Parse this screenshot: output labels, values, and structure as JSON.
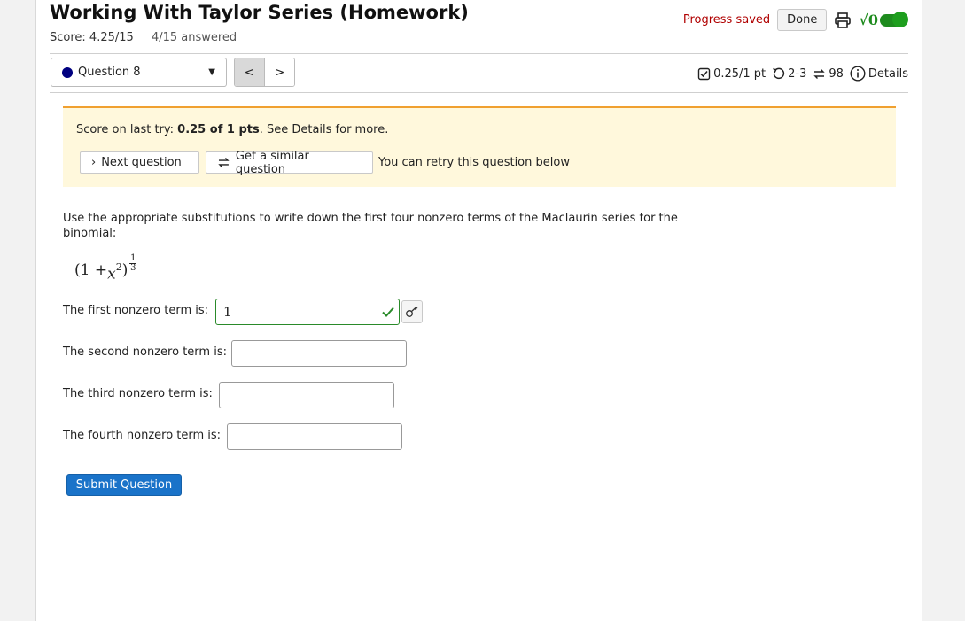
{
  "header": {
    "title": "Working With Taylor Series (Homework)",
    "score": "Score: 4.25/15",
    "answered": "4/15 answered",
    "progress_saved": "Progress saved",
    "done_label": "Done",
    "print_icon": "printer-icon",
    "math_toggle_icon": "sqrt-toggle-icon",
    "math_toggle_glyph": "√0"
  },
  "question_nav": {
    "selected_question": "Question 8",
    "prev_label": "<",
    "next_label": ">"
  },
  "question_meta": {
    "points": "0.25/1 pt",
    "attempts": "2-3",
    "versions": "98",
    "details_label": "Details"
  },
  "notice": {
    "last_try_prefix": "Score on last try: ",
    "last_try_value": "0.25 of 1 pts",
    "last_try_suffix": ". See Details for more.",
    "next_question_label": "Next question",
    "similar_question_label": "Get a similar question",
    "retry_text": "You can retry this question below"
  },
  "question": {
    "prompt": "Use the appropriate substitutions to write down the first four nonzero terms of the Maclaurin series for the binomial:",
    "expression": {
      "base_left": "(1 + ",
      "var": "x",
      "var_exp": "2",
      "base_right": ")",
      "exp_num": "1",
      "exp_den": "3"
    },
    "fields": [
      {
        "label": "The first nonzero term is:",
        "value": "1",
        "status": "correct"
      },
      {
        "label": "The second nonzero term is:",
        "value": ""
      },
      {
        "label": "The third nonzero term is:",
        "value": ""
      },
      {
        "label": "The fourth nonzero term is:",
        "value": ""
      }
    ],
    "submit_label": "Submit Question"
  },
  "colors": {
    "progress_saved": "#b00000",
    "notice_bg": "#fff8dc",
    "notice_border": "#f0a030",
    "submit_bg": "#1a73c9",
    "correct_green": "#2a8a2a",
    "question_dot": "#000080"
  }
}
